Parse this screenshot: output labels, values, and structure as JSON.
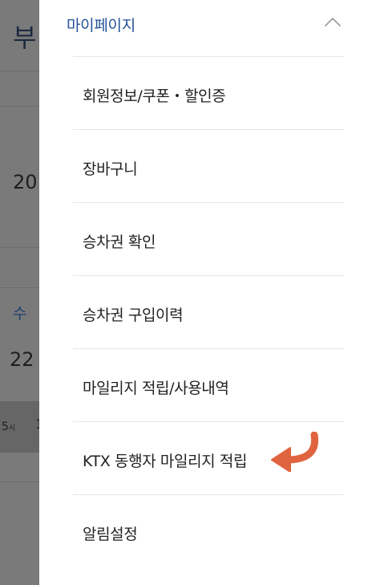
{
  "background": {
    "title_partial": "부",
    "number_1": "20",
    "day_of_week": "수",
    "number_2": "22",
    "time_partial": "5",
    "time_unit": "시",
    "mark_partial": "1"
  },
  "drawer": {
    "title": "마이페이지",
    "collapse_icon": "chevron-up-icon",
    "items": [
      {
        "label": "회원정보/쿠폰・할인증"
      },
      {
        "label": "장바구니"
      },
      {
        "label": "승차권 확인"
      },
      {
        "label": "승차권 구입이력"
      },
      {
        "label": "마일리지 적립/사용내역"
      },
      {
        "label": "KTX 동행자 마일리지 적립",
        "annotation_icon": "curved-arrow-left-icon"
      },
      {
        "label": "알림설정"
      }
    ]
  },
  "colors": {
    "title_blue": "#245398",
    "annotation_arrow": "#e0633f",
    "text_dark": "#222222",
    "overlay_grey": "#7a7a7a"
  }
}
